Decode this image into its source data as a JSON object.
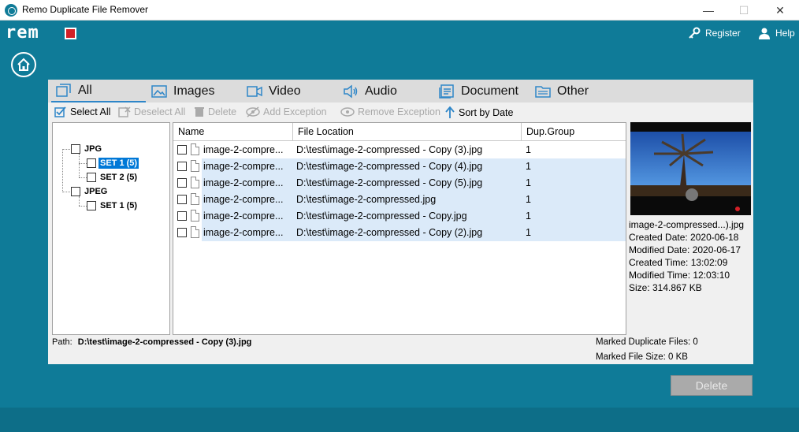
{
  "window": {
    "title": "Remo Duplicate File Remover",
    "minimize": "—",
    "maximize": "☐",
    "close": "✕"
  },
  "header": {
    "logo_text": "rem",
    "register_label": "Register",
    "help_label": "Help"
  },
  "tabs": [
    {
      "label": "All",
      "icon": "all-icon"
    },
    {
      "label": "Images",
      "icon": "image-icon"
    },
    {
      "label": "Video",
      "icon": "video-icon"
    },
    {
      "label": "Audio",
      "icon": "audio-icon"
    },
    {
      "label": "Document",
      "icon": "document-icon"
    },
    {
      "label": "Other",
      "icon": "folder-icon"
    }
  ],
  "toolbar": {
    "select_all": "Select All",
    "deselect_all": "Deselect All",
    "delete": "Delete",
    "add_exception": "Add Exception",
    "remove_exception": "Remove Exception",
    "sort_by_date": "Sort by Date"
  },
  "tree": {
    "groups": [
      {
        "label": "JPG",
        "sets": [
          "SET 1 (5)",
          "SET 2 (5)"
        ]
      },
      {
        "label": "JPEG",
        "sets": [
          "SET 1 (5)"
        ]
      }
    ],
    "selected": "SET 1 (5)"
  },
  "grid": {
    "columns": [
      "Name",
      "File Location",
      "Dup.Group"
    ],
    "rows": [
      {
        "name": "image-2-compre...",
        "location": "D:\\test\\image-2-compressed - Copy (3).jpg",
        "group": "1",
        "highlighted": false
      },
      {
        "name": "image-2-compre...",
        "location": "D:\\test\\image-2-compressed - Copy (4).jpg",
        "group": "1",
        "highlighted": true
      },
      {
        "name": "image-2-compre...",
        "location": "D:\\test\\image-2-compressed - Copy (5).jpg",
        "group": "1",
        "highlighted": true
      },
      {
        "name": "image-2-compre...",
        "location": "D:\\test\\image-2-compressed.jpg",
        "group": "1",
        "highlighted": true
      },
      {
        "name": "image-2-compre...",
        "location": "D:\\test\\image-2-compressed - Copy.jpg",
        "group": "1",
        "highlighted": true
      },
      {
        "name": "image-2-compre...",
        "location": "D:\\test\\image-2-compressed - Copy (2).jpg",
        "group": "1",
        "highlighted": true
      }
    ]
  },
  "preview": {
    "filename": "image-2-compressed...).jpg",
    "created_date": "Created Date: 2020-06-18",
    "modified_date": "Modified Date: 2020-06-17",
    "created_time": "Created Time: 13:02:09",
    "modified_time": "Modified Time: 12:03:10",
    "size": "Size: 314.867 KB"
  },
  "status": {
    "path_label": "Path:",
    "path_value": "D:\\test\\image-2-compressed - Copy (3).jpg",
    "marked_files": "Marked Duplicate Files: 0",
    "marked_size": "Marked File Size: 0 KB"
  },
  "delete_button": "Delete",
  "colors": {
    "brand": "#0f7b98",
    "accent": "#0078d7",
    "logo_red": "#d32027",
    "highlight_row": "#dbeaf9"
  }
}
